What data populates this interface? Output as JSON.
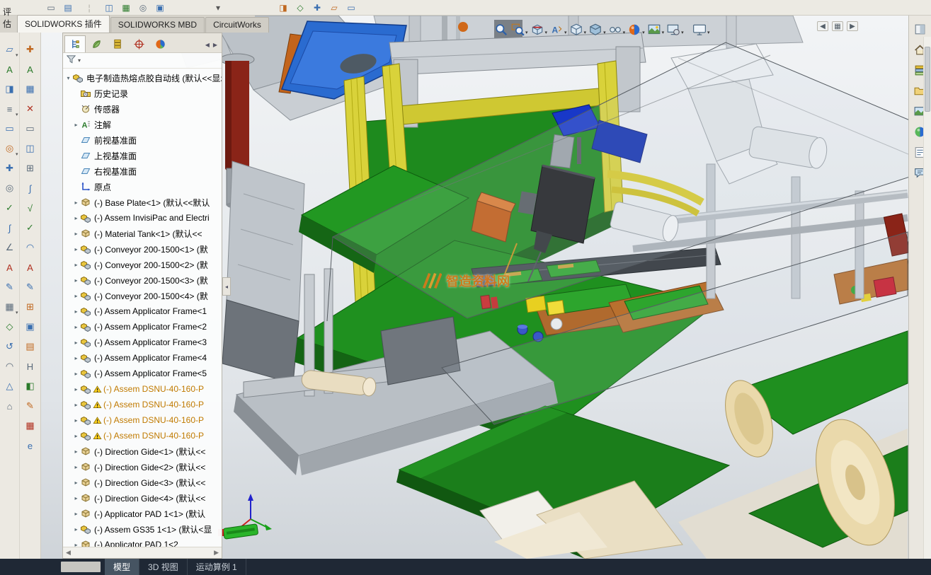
{
  "top_tabs": {
    "left_label": "评估",
    "tabs": [
      {
        "label": "SOLIDWORKS 插件",
        "active": true
      },
      {
        "label": "SOLIDWORKS MBD",
        "active": false
      },
      {
        "label": "CircuitWorks",
        "active": false
      }
    ]
  },
  "top_strip": {
    "icons": [
      {
        "name": "toolbar-fragment-icon",
        "glyph": "▭",
        "color": "#5a6a7a",
        "ml": 62
      },
      {
        "name": "toolbar-fragment-icon",
        "glyph": "▤",
        "color": "#3a6fb0",
        "ml": 4
      },
      {
        "name": "toolbar-separator",
        "glyph": "¦",
        "color": "#b0ada4",
        "ml": 10
      },
      {
        "name": "toolbar-fragment-icon",
        "glyph": "◫",
        "color": "#3a6fb0",
        "ml": 8
      },
      {
        "name": "toolbar-fragment-icon",
        "glyph": "▦",
        "color": "#2a7a2a",
        "ml": 4
      },
      {
        "name": "toolbar-fragment-icon",
        "glyph": "◎",
        "color": "#5a6a7a",
        "ml": 4
      },
      {
        "name": "toolbar-fragment-icon",
        "glyph": "▣",
        "color": "#3a6fb0",
        "ml": 4
      },
      {
        "name": "toolbar-dropdown",
        "glyph": "▾",
        "color": "#555555",
        "ml": 62
      },
      {
        "name": "toolbar-fragment-icon",
        "glyph": "◨",
        "color": "#c06820",
        "ml": 72
      },
      {
        "name": "toolbar-fragment-icon",
        "glyph": "◇",
        "color": "#2a7a2a",
        "ml": 4
      },
      {
        "name": "toolbar-fragment-icon",
        "glyph": "✚",
        "color": "#3a6fb0",
        "ml": 4
      },
      {
        "name": "toolbar-fragment-icon",
        "glyph": "▱",
        "color": "#c06820",
        "ml": 4
      },
      {
        "name": "toolbar-fragment-icon",
        "glyph": "▭",
        "color": "#3a6fb0",
        "ml": 4
      }
    ]
  },
  "left_toolbar_outer": {
    "icons": [
      {
        "name": "tool-boss-icon",
        "glyph": "▱",
        "color": "#3a6fb0",
        "caret": true
      },
      {
        "name": "tool-text-icon",
        "glyph": "A",
        "color": "#2a7a2a"
      },
      {
        "name": "tool-wizard-icon",
        "glyph": "◨",
        "color": "#3a6fb0"
      },
      {
        "name": "tool-pattern-icon",
        "glyph": "≡",
        "color": "#5a6a7a",
        "caret": true
      },
      {
        "name": "tool-slot-icon",
        "glyph": "▭",
        "color": "#3a6fb0"
      },
      {
        "name": "tool-circle-icon",
        "glyph": "◎",
        "color": "#c06820",
        "caret": true
      },
      {
        "name": "tool-add-icon",
        "glyph": "✚",
        "color": "#3a6fb0"
      },
      {
        "name": "tool-target-icon",
        "glyph": "◎",
        "color": "#5a6a7a"
      },
      {
        "name": "tool-check-icon",
        "glyph": "✓",
        "color": "#2a7a2a"
      },
      {
        "name": "tool-spline-icon",
        "glyph": "∫",
        "color": "#3a6fb0"
      },
      {
        "name": "tool-angle-icon",
        "glyph": "∠",
        "color": "#5a6a7a"
      },
      {
        "name": "tool-annotation-icon",
        "glyph": "A",
        "color": "#b03020"
      },
      {
        "name": "tool-sketch-icon",
        "glyph": "✎",
        "color": "#3a6fb0"
      },
      {
        "name": "tool-table-icon",
        "glyph": "▦",
        "color": "#5a6a7a",
        "caret": true
      },
      {
        "name": "tool-diamond-icon",
        "glyph": "◇",
        "color": "#2a7a2a"
      },
      {
        "name": "tool-rotate-icon",
        "glyph": "↺",
        "color": "#3a6fb0"
      },
      {
        "name": "tool-arc-icon",
        "glyph": "◠",
        "color": "#5a6a7a"
      },
      {
        "name": "tool-triangle-icon",
        "glyph": "△",
        "color": "#3a6fb0"
      },
      {
        "name": "tool-home-icon",
        "glyph": "⌂",
        "color": "#5a6a7a"
      }
    ]
  },
  "left_toolbar_inner": {
    "icons": [
      {
        "name": "tool-assembly-features-icon",
        "glyph": "✚",
        "color": "#c06820"
      },
      {
        "name": "tool-text-icon",
        "glyph": "A",
        "color": "#2a7a2a"
      },
      {
        "name": "tool-grid-icon",
        "glyph": "▦",
        "color": "#3a6fb0"
      },
      {
        "name": "tool-delete-icon",
        "glyph": "✕",
        "color": "#b03020"
      },
      {
        "name": "tool-slot-icon",
        "glyph": "▭",
        "color": "#5a6a7a"
      },
      {
        "name": "tool-mate-icon",
        "glyph": "◫",
        "color": "#3a6fb0"
      },
      {
        "name": "tool-insert-icon",
        "glyph": "⊞",
        "color": "#5a6a7a"
      },
      {
        "name": "tool-spring-icon",
        "glyph": "∫",
        "color": "#3a6fb0"
      },
      {
        "name": "tool-equation-icon",
        "glyph": "√",
        "color": "#2a7a2a"
      },
      {
        "name": "tool-check-icon",
        "glyph": "✓",
        "color": "#2a7a2a"
      },
      {
        "name": "tool-arc-icon",
        "glyph": "◠",
        "color": "#3a6fb0"
      },
      {
        "name": "tool-note-icon",
        "glyph": "A",
        "color": "#b03020"
      },
      {
        "name": "tool-pencil-icon",
        "glyph": "✎",
        "color": "#3a6fb0"
      },
      {
        "name": "tool-pattern-icon",
        "glyph": "⊞",
        "color": "#c06820"
      },
      {
        "name": "tool-3d-icon",
        "glyph": "▣",
        "color": "#3a6fb0"
      },
      {
        "name": "tool-book-icon",
        "glyph": "▤",
        "color": "#c06820"
      },
      {
        "name": "tool-h-icon",
        "glyph": "H",
        "color": "#5a6a7a"
      },
      {
        "name": "tool-fill-icon",
        "glyph": "◧",
        "color": "#2a7a2a"
      },
      {
        "name": "tool-draw-icon",
        "glyph": "✎",
        "color": "#c06820"
      },
      {
        "name": "tool-schedule-icon",
        "glyph": "▦",
        "color": "#b03020"
      },
      {
        "name": "tool-internet-icon",
        "glyph": "e",
        "color": "#3a6fb0"
      }
    ]
  },
  "feature_panel": {
    "tabs": [
      {
        "name": "featuremanager-tab",
        "icon": "featuremanager-tab-icon",
        "active": true
      },
      {
        "name": "propertymanager-tab",
        "icon": "propertymanager-tab-icon",
        "active": false
      },
      {
        "name": "configurationmanager-tab",
        "icon": "configurationmanager-tab-icon",
        "active": false
      },
      {
        "name": "dimxpert-tab",
        "icon": "dimxpert-tab-icon",
        "active": false
      },
      {
        "name": "displaymanager-tab",
        "icon": "displaymanager-tab-icon",
        "active": false
      }
    ],
    "tab_scroll": [
      "◀",
      "▶"
    ],
    "hscroll": [
      "◀",
      "▶"
    ],
    "root_label": "电子制造热熔点胶自动线 (默认<<显示",
    "items": [
      {
        "icon": "history-icon",
        "label": "历史记录"
      },
      {
        "icon": "sensor-icon",
        "label": "传感器"
      },
      {
        "icon": "annotation-icon",
        "label": "注解",
        "arrow": true
      },
      {
        "icon": "plane-icon",
        "label": "前视基准面"
      },
      {
        "icon": "plane-icon",
        "label": "上视基准面"
      },
      {
        "icon": "plane-icon",
        "label": "右视基准面"
      },
      {
        "icon": "origin-icon",
        "label": "原点"
      },
      {
        "icon": "part-icon",
        "label": "(-) Base Plate<1> (默认<<默认",
        "arrow": true
      },
      {
        "icon": "assembly-icon",
        "label": "(-) Assem InvisiPac and Electri",
        "arrow": true
      },
      {
        "icon": "part-icon",
        "label": "(-) Material Tank<1> (默认<<",
        "arrow": true
      },
      {
        "icon": "assembly-icon",
        "label": "(-) Conveyor 200-1500<1> (默",
        "arrow": true
      },
      {
        "icon": "assembly-icon",
        "label": "(-) Conveyor 200-1500<2> (默",
        "arrow": true
      },
      {
        "icon": "assembly-icon",
        "label": "(-) Conveyor 200-1500<3> (默",
        "arrow": true
      },
      {
        "icon": "assembly-icon",
        "label": "(-) Conveyor 200-1500<4> (默",
        "arrow": true
      },
      {
        "icon": "assembly-icon",
        "label": "(-) Assem Applicator Frame<1",
        "arrow": true
      },
      {
        "icon": "assembly-icon",
        "label": "(-) Assem Applicator Frame<2",
        "arrow": true
      },
      {
        "icon": "assembly-icon",
        "label": "(-) Assem Applicator Frame<3",
        "arrow": true
      },
      {
        "icon": "assembly-icon",
        "label": "(-) Assem Applicator Frame<4",
        "arrow": true
      },
      {
        "icon": "assembly-icon",
        "label": "(-) Assem Applicator Frame<5",
        "arrow": true
      },
      {
        "icon": "assembly-icon",
        "label": "(-) Assem DSNU-40-160-P",
        "arrow": true,
        "warning": true
      },
      {
        "icon": "assembly-icon",
        "label": "(-) Assem DSNU-40-160-P",
        "arrow": true,
        "warning": true
      },
      {
        "icon": "assembly-icon",
        "label": "(-) Assem DSNU-40-160-P",
        "arrow": true,
        "warning": true
      },
      {
        "icon": "assembly-icon",
        "label": "(-) Assem DSNU-40-160-P",
        "arrow": true,
        "warning": true
      },
      {
        "icon": "part-icon",
        "label": "(-) Direction Gide<1> (默认<<",
        "arrow": true
      },
      {
        "icon": "part-icon",
        "label": "(-) Direction Gide<2> (默认<<",
        "arrow": true
      },
      {
        "icon": "part-icon",
        "label": "(-) Direction Gide<3> (默认<<",
        "arrow": true
      },
      {
        "icon": "part-icon",
        "label": "(-) Direction Gide<4> (默认<<",
        "arrow": true
      },
      {
        "icon": "part-icon",
        "label": "(-) Applicator PAD 1<1> (默认",
        "arrow": true
      },
      {
        "icon": "assembly-icon",
        "label": "(-) Assem GS35 1<1> (默认<显",
        "arrow": true
      },
      {
        "icon": "part-icon",
        "label": "(-) Applicator PAD 1<2",
        "arrow": true
      }
    ]
  },
  "headsup_toolbar": {
    "icons": [
      {
        "name": "zoom-fit-icon"
      },
      {
        "name": "zoom-area-icon",
        "caret": true
      },
      {
        "name": "section-view-icon",
        "caret": true
      },
      {
        "name": "dynamic-annotation-icon",
        "caret": true
      },
      {
        "name": "view-orientation-icon",
        "caret": true
      },
      {
        "name": "display-style-icon",
        "caret": true
      },
      {
        "name": "hide-items-icon",
        "caret": true
      },
      {
        "name": "edit-appearance-icon",
        "caret": true
      },
      {
        "name": "apply-scene-icon",
        "caret": true
      },
      {
        "name": "view-settings-icon",
        "caret": true
      }
    ],
    "monitor": {
      "name": "monitor-icon",
      "caret": true
    },
    "view_buttons": [
      {
        "name": "prev-view-icon",
        "glyph": "◀"
      },
      {
        "name": "viewports-icon",
        "glyph": "▦"
      },
      {
        "name": "next-view-icon",
        "glyph": "▶"
      }
    ]
  },
  "task_pane": {
    "icons": [
      {
        "name": "pin-panel-icon"
      },
      {
        "name": "home-icon"
      },
      {
        "name": "design-library-icon"
      },
      {
        "name": "file-explorer-icon"
      },
      {
        "name": "view-palette-icon"
      },
      {
        "name": "appearances-icon"
      },
      {
        "name": "custom-properties-icon"
      },
      {
        "name": "forum-icon"
      }
    ]
  },
  "statusbar": {
    "tabs": [
      {
        "label": "模型",
        "active": true
      },
      {
        "label": "3D 视图",
        "active": false
      },
      {
        "label": "运动算例 1",
        "active": false
      }
    ]
  },
  "watermark": {
    "text": "智造资料网"
  }
}
